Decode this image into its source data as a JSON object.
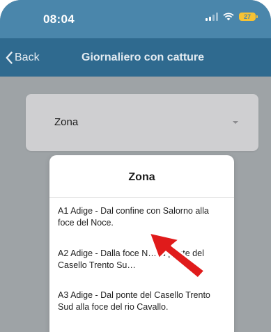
{
  "status": {
    "time": "08:04",
    "battery": "27"
  },
  "nav": {
    "back_label": "Back",
    "title": "Giornaliero con catture"
  },
  "select": {
    "label": "Zona"
  },
  "dialog": {
    "title": "Zona",
    "options": [
      {
        "label": "A1 Adige - Dal confine con Salorno alla foce del Noce."
      },
      {
        "label": "A2 Adige - Dalla foce N… al ponte del Casello Trento Su…"
      },
      {
        "label": "A3 Adige - Dal ponte del Casello Trento Sud alla foce del rio Cavallo."
      }
    ]
  },
  "colors": {
    "statusbar": "#4a86ab",
    "navbar": "#2f6a8f",
    "overlay": "#9ea3a6",
    "select_bg": "#cfcfd1",
    "arrow": "#e01b1b",
    "battery": "#f6c233"
  }
}
